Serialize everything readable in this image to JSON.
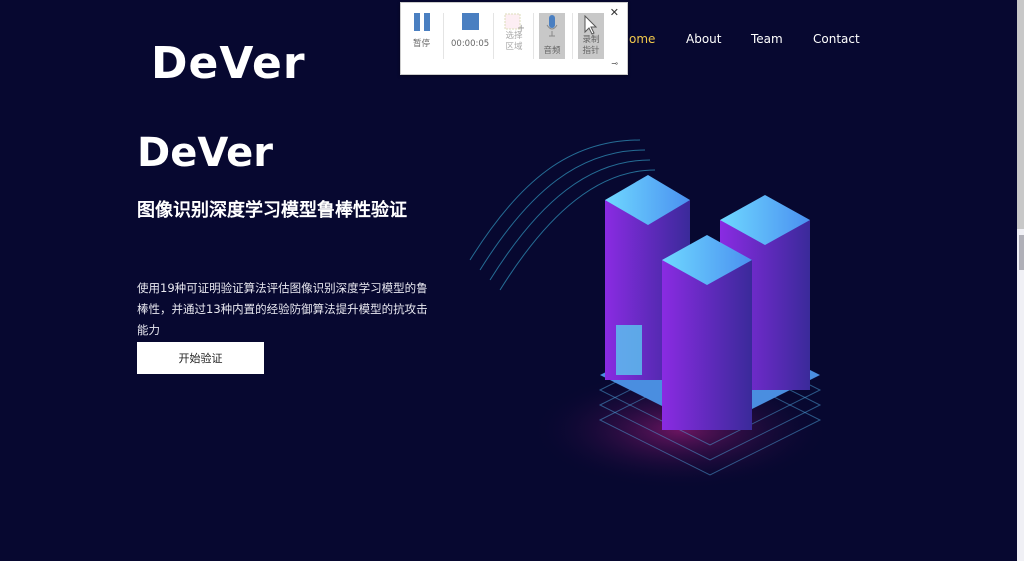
{
  "logo": "DeVer",
  "nav": {
    "items": [
      {
        "label": "Home",
        "active": true
      },
      {
        "label": "About"
      },
      {
        "label": "Team"
      },
      {
        "label": "Contact"
      }
    ],
    "active_color": "#f2c94c"
  },
  "hero": {
    "title": "DeVer",
    "subtitle": "图像识别深度学习模型鲁棒性验证",
    "description": "使用19种可证明验证算法评估图像识别深度学习模型的鲁棒性，并通过13种内置的经验防御算法提升模型的抗攻击能力",
    "cta_label": "开始验证"
  },
  "recorder": {
    "pause_label": "暂停",
    "timer": "00:00:05",
    "select_area_label": "选择区域",
    "audio_label": "音频",
    "record_pointer_label": "录制指针",
    "close_icon": "close-icon",
    "pin_icon": "pin-icon"
  },
  "colors": {
    "background": "#070830",
    "accent": "#4a7fc1"
  }
}
